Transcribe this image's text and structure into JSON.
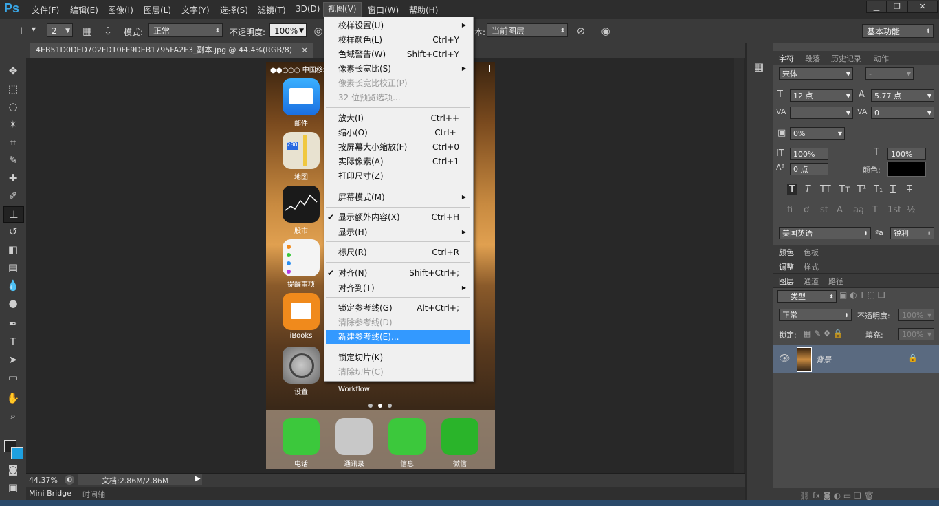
{
  "app": {
    "logo": "Ps"
  },
  "menubar": {
    "items": [
      "文件(F)",
      "编辑(E)",
      "图像(I)",
      "图层(L)",
      "文字(Y)",
      "选择(S)",
      "滤镜(T)",
      "3D(D)",
      "视图(V)",
      "窗口(W)",
      "帮助(H)"
    ],
    "active": "视图(V)"
  },
  "options": {
    "brush_size": "2",
    "mode_label": "模式:",
    "mode_value": "正常",
    "opacity_label": "不透明度:",
    "opacity_value": "100%",
    "sample_suffix": "本:",
    "sample_value": "当前图层",
    "workspace": "基本功能"
  },
  "document": {
    "tab_title": "4EB51D0DED702FD10FF9DEB1795FA2E3_副本.jpg @ 44.4%(RGB/8)",
    "close": "×",
    "zoom": "44.37%",
    "doc_info": "文档:2.86M/2.86M",
    "bottom_tabs": [
      "Mini Bridge",
      "时间轴"
    ]
  },
  "phone": {
    "carrier": "●●○○○ 中国移动",
    "apps": [
      {
        "label": "邮件",
        "color": "#2a8ef0"
      },
      {
        "label": "地图",
        "color": "#e8e2d0"
      },
      {
        "label": "股市",
        "color": "#1a1a1a"
      },
      {
        "label": "提醒事项",
        "color": "#f4f4f4"
      },
      {
        "label": "iBooks",
        "color": "#f08a1c"
      },
      {
        "label": "设置",
        "color": "#8a8a8a"
      }
    ],
    "workflow_label": "Workflow",
    "dock": [
      {
        "label": "电话",
        "color": "#3cc83c"
      },
      {
        "label": "通讯录",
        "color": "#c8c8c8"
      },
      {
        "label": "信息",
        "color": "#3cc83c"
      },
      {
        "label": "微信",
        "color": "#2ab42a"
      }
    ]
  },
  "viewmenu": {
    "items": [
      {
        "label": "校样设置(U)",
        "shortcut": "",
        "submenu": true,
        "disabled": false,
        "checked": false
      },
      {
        "label": "校样颜色(L)",
        "shortcut": "Ctrl+Y",
        "submenu": false,
        "disabled": false,
        "checked": false
      },
      {
        "label": "色域警告(W)",
        "shortcut": "Shift+Ctrl+Y",
        "submenu": false,
        "disabled": false,
        "checked": false
      },
      {
        "label": "像素长宽比(S)",
        "shortcut": "",
        "submenu": true,
        "disabled": false,
        "checked": false
      },
      {
        "label": "像素长宽比校正(P)",
        "shortcut": "",
        "submenu": false,
        "disabled": true,
        "checked": false
      },
      {
        "label": "32 位预览选项...",
        "shortcut": "",
        "submenu": false,
        "disabled": true,
        "checked": false
      },
      {
        "label": "放大(I)",
        "shortcut": "Ctrl++",
        "submenu": false,
        "disabled": false,
        "checked": false
      },
      {
        "label": "缩小(O)",
        "shortcut": "Ctrl+-",
        "submenu": false,
        "disabled": false,
        "checked": false
      },
      {
        "label": "按屏幕大小缩放(F)",
        "shortcut": "Ctrl+0",
        "submenu": false,
        "disabled": false,
        "checked": false
      },
      {
        "label": "实际像素(A)",
        "shortcut": "Ctrl+1",
        "submenu": false,
        "disabled": false,
        "checked": false
      },
      {
        "label": "打印尺寸(Z)",
        "shortcut": "",
        "submenu": false,
        "disabled": false,
        "checked": false
      },
      {
        "label": "屏幕模式(M)",
        "shortcut": "",
        "submenu": true,
        "disabled": false,
        "checked": false
      },
      {
        "label": "显示额外内容(X)",
        "shortcut": "Ctrl+H",
        "submenu": false,
        "disabled": false,
        "checked": true
      },
      {
        "label": "显示(H)",
        "shortcut": "",
        "submenu": true,
        "disabled": false,
        "checked": false
      },
      {
        "label": "标尺(R)",
        "shortcut": "Ctrl+R",
        "submenu": false,
        "disabled": false,
        "checked": false
      },
      {
        "label": "对齐(N)",
        "shortcut": "Shift+Ctrl+;",
        "submenu": false,
        "disabled": false,
        "checked": true
      },
      {
        "label": "对齐到(T)",
        "shortcut": "",
        "submenu": true,
        "disabled": false,
        "checked": false
      },
      {
        "label": "锁定参考线(G)",
        "shortcut": "Alt+Ctrl+;",
        "submenu": false,
        "disabled": false,
        "checked": false
      },
      {
        "label": "清除参考线(D)",
        "shortcut": "",
        "submenu": false,
        "disabled": true,
        "checked": false
      },
      {
        "label": "新建参考线(E)...",
        "shortcut": "",
        "submenu": false,
        "disabled": false,
        "checked": false,
        "highlighted": true
      },
      {
        "label": "锁定切片(K)",
        "shortcut": "",
        "submenu": false,
        "disabled": false,
        "checked": false
      },
      {
        "label": "清除切片(C)",
        "shortcut": "",
        "submenu": false,
        "disabled": true,
        "checked": false
      }
    ],
    "check_mark": "✔",
    "submenu_arrow": "▶"
  },
  "char_panel": {
    "tabs": [
      "字符",
      "段落",
      "历史记录",
      "动作"
    ],
    "font_family": "宋体",
    "font_style": "-",
    "font_size": "12 点",
    "leading": "5.77 点",
    "kerning": "",
    "tracking": "0",
    "scale": "0%",
    "vscale": "100%",
    "hscale": "100%",
    "baseline": "0 点",
    "color_label": "颜色:",
    "language": "美国英语",
    "aa_label": "ªa",
    "antialias": "锐利"
  },
  "panels": {
    "color_tabs": [
      "颜色",
      "色板"
    ],
    "adjust_tabs": [
      "调整",
      "样式"
    ],
    "layer_tabs": [
      "图层",
      "通道",
      "路径"
    ],
    "filter_kind": "类型",
    "blend_mode": "正常",
    "opacity_label": "不透明度:",
    "opacity_value": "100%",
    "lock_label": "锁定:",
    "fill_label": "填充:",
    "fill_value": "100%",
    "layer_name": "背景"
  },
  "colors": {
    "accent": "#3399ff",
    "fg_swatch": "#222222",
    "bg_swatch": "#1ea0e0"
  }
}
